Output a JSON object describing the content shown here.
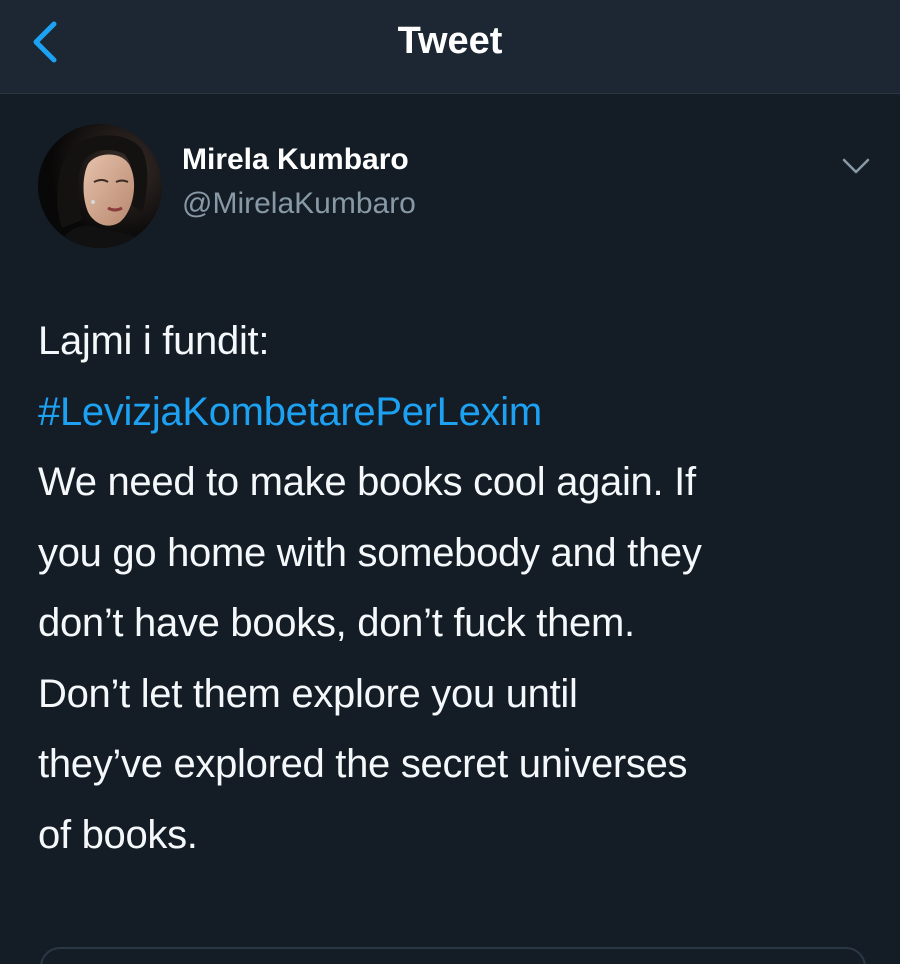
{
  "header": {
    "title": "Tweet",
    "back_icon": "chevron-left-icon",
    "accent_color": "#1da1f2"
  },
  "tweet": {
    "author": {
      "display_name": "Mirela Kumbaro",
      "handle": "@MirelaKumbaro",
      "avatar_icon": "profile-photo"
    },
    "menu_icon": "chevron-down-icon",
    "body": {
      "line1": "Lajmi i fundit:",
      "hashtag": "#LevizjaKombetarePerLexim",
      "line3": "We need to make books cool again. If",
      "line4": "you go home with somebody and they",
      "line5": "don’t have books, don’t fuck them.",
      "line6": "Don’t let them explore you until",
      "line7": "they’ve explored the secret universes",
      "line8": "of books."
    }
  },
  "colors": {
    "background": "#141d26",
    "header_background": "#1c2733",
    "text_primary": "#ffffff",
    "text_secondary": "#8899a6",
    "link": "#1da1f2"
  }
}
